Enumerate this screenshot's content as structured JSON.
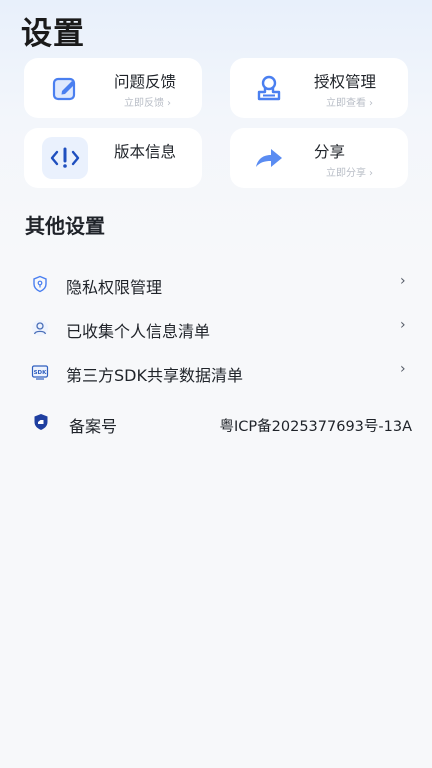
{
  "header": {
    "title": "设置"
  },
  "cards": [
    {
      "title": "问题反馈",
      "subtitle": "立即反馈",
      "icon": "feedback-edit-icon"
    },
    {
      "title": "授权管理",
      "subtitle": "立即查看",
      "icon": "stamp-icon"
    },
    {
      "title": "版本信息",
      "subtitle": "",
      "icon": "version-code-icon"
    },
    {
      "title": "分享",
      "subtitle": "立即分享",
      "icon": "share-arrow-icon"
    }
  ],
  "other_settings": {
    "title": "其他设置",
    "items": [
      {
        "label": "隐私权限管理",
        "icon": "privacy-shield-icon"
      },
      {
        "label": "已收集个人信息清单",
        "icon": "user-icon"
      },
      {
        "label": "第三方SDK共享数据清单",
        "icon": "sdk-icon"
      }
    ],
    "chevron": "›"
  },
  "beian": {
    "label": "备案号",
    "value": "粤ICP备2025377693号-13A",
    "icon": "beian-shield-icon"
  },
  "colors": {
    "accent": "#4a7ff0",
    "card_bg": "#ffffff",
    "page_bg": "#f7f8fa",
    "subtle_text": "#b9bec7"
  },
  "card_chevron": "›"
}
